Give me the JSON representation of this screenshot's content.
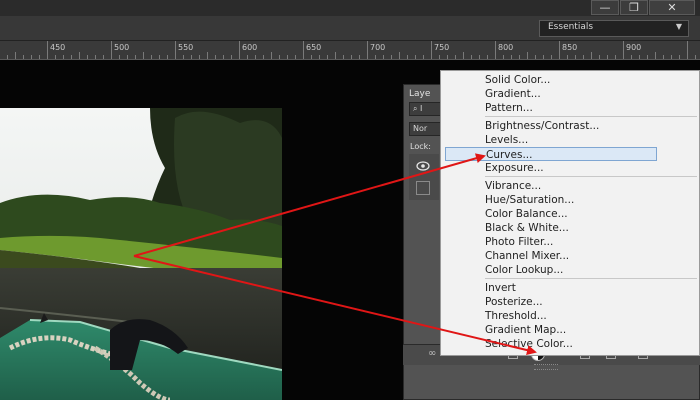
{
  "window": {
    "minimize_glyph": "—",
    "restore_glyph": "❐",
    "close_glyph": "✕"
  },
  "optionsbar": {
    "workspace_label": "Essentials",
    "workspace_arrow": "▼"
  },
  "ruler": {
    "labels": [
      "450",
      "500",
      "550",
      "600",
      "650",
      "700",
      "750",
      "800",
      "850",
      "900"
    ]
  },
  "layers_panel": {
    "tab_label": "Laye",
    "filter_glyph": "⌕ I",
    "blend_mode": "Nor",
    "lock_label": "Lock:"
  },
  "adjustment_menu": {
    "groups": [
      [
        "Solid Color...",
        "Gradient...",
        "Pattern..."
      ],
      [
        "Brightness/Contrast...",
        "Levels...",
        "Curves...",
        "Exposure..."
      ],
      [
        "Vibrance...",
        "Hue/Saturation...",
        "Color Balance...",
        "Black & White...",
        "Photo Filter...",
        "Channel Mixer...",
        "Color Lookup..."
      ],
      [
        "Invert",
        "Posterize...",
        "Threshold...",
        "Gradient Map...",
        "Selective Color..."
      ]
    ],
    "highlighted": "Curves..."
  },
  "colors": {
    "annotation_arrow": "#e01616",
    "menu_highlight": "#dbe8f6",
    "panel_bg": "#535353"
  }
}
